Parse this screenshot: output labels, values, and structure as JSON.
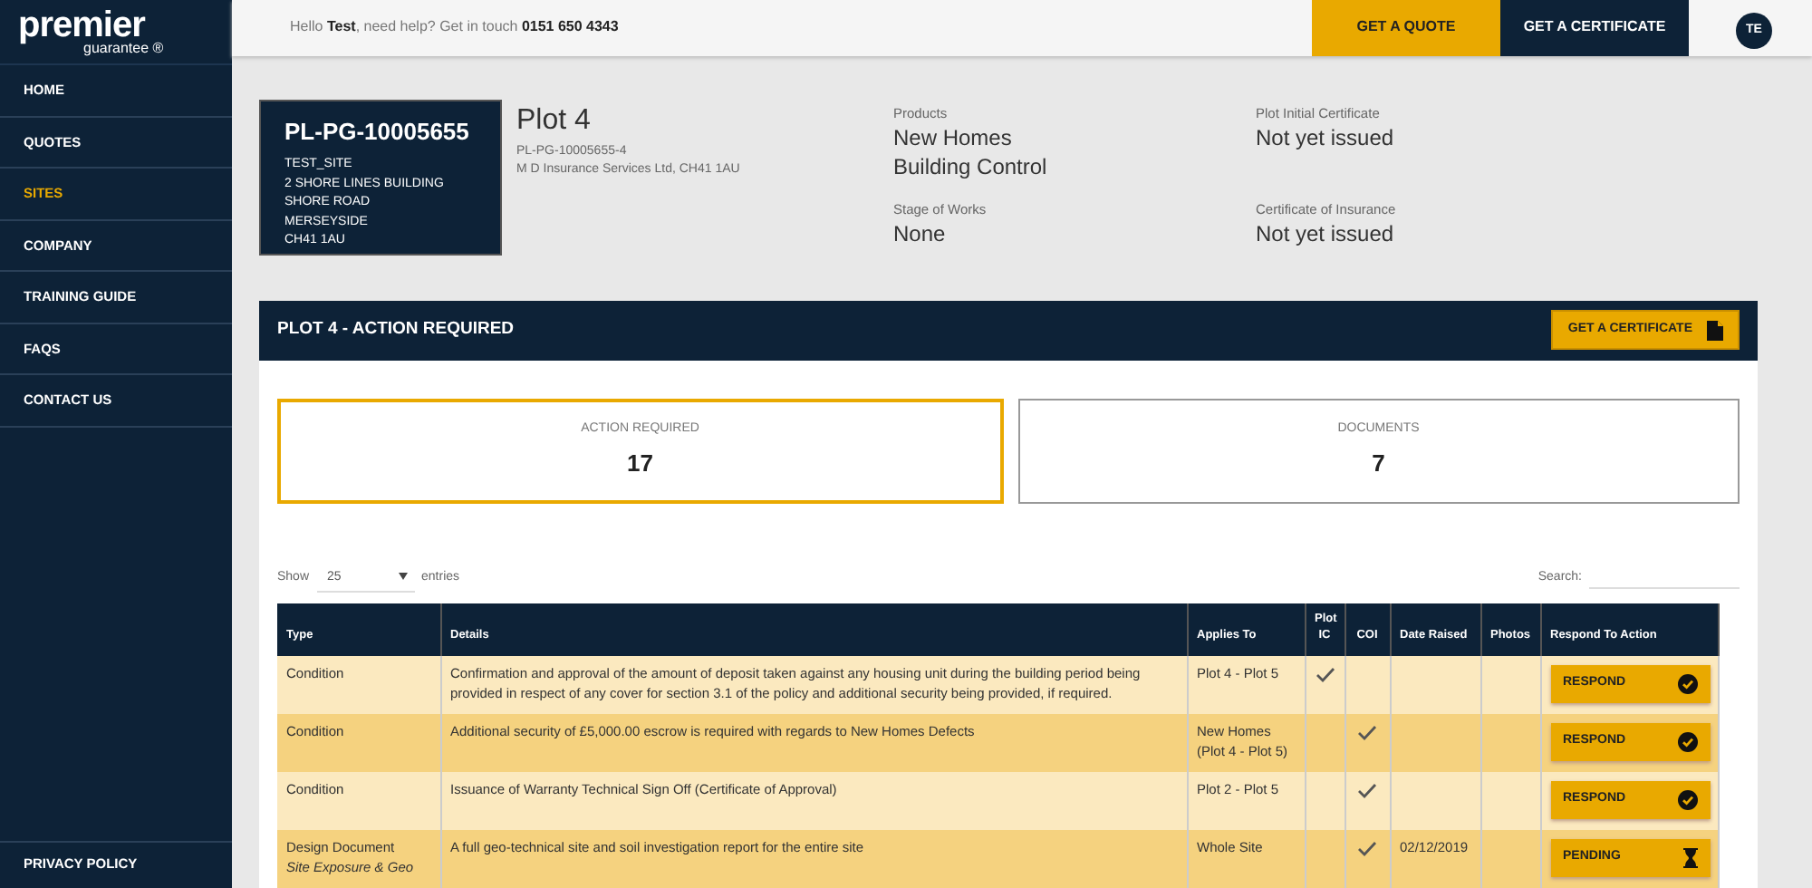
{
  "logo": {
    "name": "premier",
    "sub": "guarantee",
    "mark": "®"
  },
  "sidebar": {
    "items": [
      {
        "label": "HOME",
        "selected": false
      },
      {
        "label": "QUOTES",
        "selected": false
      },
      {
        "label": "SITES",
        "selected": true
      },
      {
        "label": "COMPANY",
        "selected": false
      },
      {
        "label": "TRAINING GUIDE",
        "selected": false
      },
      {
        "label": "FAQS",
        "selected": false
      },
      {
        "label": "CONTACT US",
        "selected": false
      }
    ],
    "footer": "PRIVACY POLICY"
  },
  "topbar": {
    "greeting": "Hello **Test**, need help? Get in touch **0151 650 4343**",
    "buttons": [
      "GET A QUOTE",
      "GET A CERTIFICATE"
    ],
    "avatar": "TE"
  },
  "site_card": {
    "ref": "PL-PG-10005655",
    "lines": [
      "TEST_SITE",
      "2 SHORE LINES BUILDING",
      "SHORE ROAD",
      "MERSEYSIDE",
      "CH41 1AU"
    ]
  },
  "plot": {
    "title": "Plot 4",
    "ref": "PL-PG-10005655-4",
    "company": "M D Insurance Services Ltd, CH41 1AU"
  },
  "facts": [
    {
      "label": "Products",
      "values": [
        "New Homes",
        "Building Control"
      ]
    },
    {
      "label": "Plot Initial Certificate",
      "values": [
        "Not yet issued"
      ]
    },
    {
      "label": "Stage of Works",
      "values": [
        "None"
      ]
    },
    {
      "label": "Certificate of Insurance",
      "values": [
        "Not yet issued"
      ]
    }
  ],
  "panel": {
    "title": "PLOT 4 - ACTION REQUIRED",
    "button": "GET A CERTIFICATE"
  },
  "stats": [
    {
      "label": "ACTION REQUIRED",
      "value": "17",
      "selected": true
    },
    {
      "label": "DOCUMENTS",
      "value": "7",
      "selected": false
    }
  ],
  "table_controls": {
    "show": "Show",
    "entries_value": "25",
    "entries": "entries",
    "search": "Search:"
  },
  "table": {
    "columns": [
      "Type",
      "Details",
      "Applies To",
      "Plot IC",
      "COI",
      "Date Raised",
      "Photos",
      "Respond To Action"
    ],
    "rows": [
      {
        "type": "Condition",
        "subtype": null,
        "details": "Confirmation and approval of the amount of deposit taken against any housing unit during the building period being provided in respect of any cover for section 3.1 of the policy and additional security being provided, if required.",
        "applies_to": "Plot 4 - Plot 5",
        "plot_ic": true,
        "coi": false,
        "date_raised": "",
        "action": {
          "label": "RESPOND",
          "kind": "respond"
        }
      },
      {
        "type": "Condition",
        "subtype": null,
        "details": "Additional security of £5,000.00 escrow is required with regards to New Homes Defects",
        "applies_to": "New Homes (Plot 4 - Plot 5)",
        "plot_ic": false,
        "coi": true,
        "date_raised": "",
        "action": {
          "label": "RESPOND",
          "kind": "respond"
        }
      },
      {
        "type": "Condition",
        "subtype": null,
        "details": "Issuance of Warranty Technical Sign Off (Certificate of Approval)",
        "applies_to": "Plot 2 - Plot 5",
        "plot_ic": false,
        "coi": true,
        "date_raised": "",
        "action": {
          "label": "RESPOND",
          "kind": "respond"
        }
      },
      {
        "type": "Design Document",
        "subtype": "Site Exposure & Geo",
        "details": "A full geo-technical site and soil investigation report for the entire site",
        "applies_to": "Whole Site",
        "plot_ic": false,
        "coi": true,
        "date_raised": "02/12/2019",
        "action": {
          "label": "PENDING",
          "kind": "pending"
        }
      }
    ]
  }
}
